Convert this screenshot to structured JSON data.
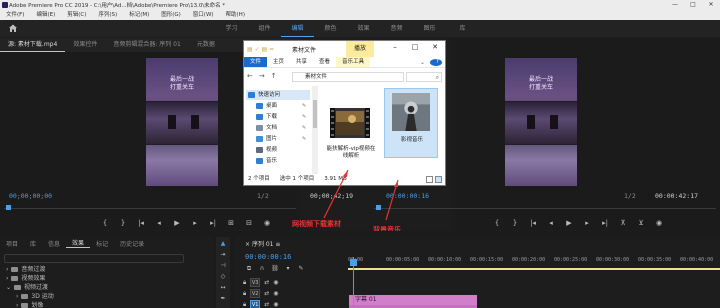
{
  "app": {
    "title": "Adobe Premiere Pro CC 2019 - C:\\用户\\Ad...档\\Adobe\\Premiere Pro\\13.0\\未命名 *",
    "window_controls": [
      "—",
      "□",
      "✕"
    ]
  },
  "menu": [
    "文件(F)",
    "编辑(E)",
    "剪辑(C)",
    "序列(S)",
    "标记(M)",
    "图形(G)",
    "窗口(W)",
    "帮助(H)"
  ],
  "workspaces": {
    "tabs": [
      "学习",
      "组件",
      "编辑",
      "颜色",
      "效果",
      "音频",
      "图形",
      "库"
    ],
    "active": "编辑"
  },
  "source_panel": {
    "tabs": [
      "源: 素材下载.mp4",
      "效果控件",
      "音频剪辑混合器: 序列 01",
      "元数据"
    ],
    "caption_lines": [
      "最后一战",
      "打重关车"
    ],
    "timecode_in": "00;00;00;00",
    "fit": "1/2",
    "timecode_out": "00;00;42;19"
  },
  "program_panel": {
    "timecode_in": "00:00:00:16",
    "fit": "1/2",
    "timecode_out": "00:00:42:17",
    "caption_lines": [
      "最后一战",
      "打重关车"
    ]
  },
  "explorer": {
    "window_title": "素材文件",
    "manage_label": "播放",
    "ribbon": [
      "文件",
      "主页",
      "共享",
      "查看",
      "音乐工具"
    ],
    "path": "素材文件",
    "nav_items": [
      {
        "label": "快速访问",
        "icon": "star-icon",
        "color": "#2d7fd6"
      },
      {
        "label": "桌面",
        "icon": "desktop-icon",
        "color": "#2d7fd6"
      },
      {
        "label": "下载",
        "icon": "download-icon",
        "color": "#2d7fd6"
      },
      {
        "label": "文档",
        "icon": "document-icon",
        "color": "#7d8da3"
      },
      {
        "label": "图片",
        "icon": "picture-icon",
        "color": "#3f8fd8"
      },
      {
        "label": "视频",
        "icon": "video-icon",
        "color": "#5a6b80"
      },
      {
        "label": "音乐",
        "icon": "music-icon",
        "color": "#2d7fd6"
      }
    ],
    "files": [
      {
        "name": "能扶解析-vip视频在线解析",
        "kind": "video"
      },
      {
        "name": "影视音乐",
        "kind": "music"
      }
    ],
    "status_count": "2 个项目",
    "status_selected": "选中 1 个项目",
    "status_size": "3.91 MB"
  },
  "annotations": {
    "video_label": "网视频下载素材",
    "music_label": "背景音乐"
  },
  "project_panel": {
    "tabs": [
      "项目",
      "库",
      "信息",
      "效果",
      "标记",
      "历史记录"
    ],
    "active": "效果",
    "tree": [
      "预设",
      "Lumetri 预设",
      "音频效果",
      "音频过渡",
      "视频效果",
      "视频过渡",
      "3D 运动",
      "划像"
    ]
  },
  "timeline": {
    "sequence_tab": "序列 01",
    "timecode": "00:00:00:16",
    "ruler_labels": [
      "00:00",
      "00:00:05:00",
      "00:00:10:00",
      "00:00:15:00",
      "00:00:20:00",
      "00:00:25:00",
      "00:00:30:00",
      "00:00:35:00",
      "00:00:40:00"
    ],
    "tracks": [
      "V3",
      "V2",
      "V1"
    ],
    "title_clip": "字幕 01"
  }
}
